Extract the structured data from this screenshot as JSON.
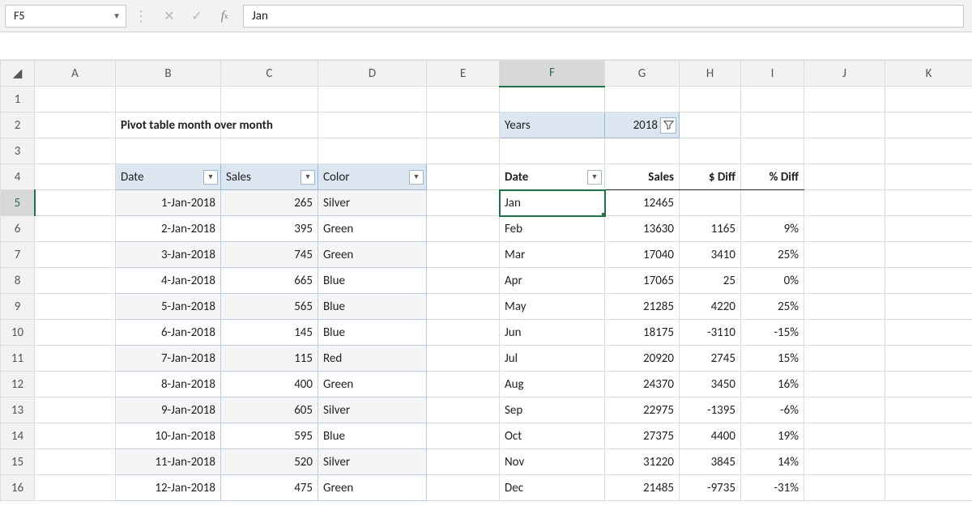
{
  "formula_bar": {
    "cell_ref": "F5",
    "value": "Jan"
  },
  "columns": [
    "A",
    "B",
    "C",
    "D",
    "E",
    "F",
    "G",
    "H",
    "I",
    "J",
    "K"
  ],
  "rownums": [
    1,
    2,
    3,
    4,
    5,
    6,
    7,
    8,
    9,
    10,
    11,
    12,
    13,
    14,
    15,
    16
  ],
  "title": "Pivot table month over month",
  "filter": {
    "label": "Years",
    "value": "2018"
  },
  "left_table": {
    "headers": {
      "date": "Date",
      "sales": "Sales",
      "color": "Color"
    },
    "rows": [
      {
        "date": "1-Jan-2018",
        "sales": "265",
        "color": "Silver"
      },
      {
        "date": "2-Jan-2018",
        "sales": "395",
        "color": "Green"
      },
      {
        "date": "3-Jan-2018",
        "sales": "745",
        "color": "Green"
      },
      {
        "date": "4-Jan-2018",
        "sales": "665",
        "color": "Blue"
      },
      {
        "date": "5-Jan-2018",
        "sales": "565",
        "color": "Blue"
      },
      {
        "date": "6-Jan-2018",
        "sales": "145",
        "color": "Blue"
      },
      {
        "date": "7-Jan-2018",
        "sales": "115",
        "color": "Red"
      },
      {
        "date": "8-Jan-2018",
        "sales": "400",
        "color": "Green"
      },
      {
        "date": "9-Jan-2018",
        "sales": "605",
        "color": "Silver"
      },
      {
        "date": "10-Jan-2018",
        "sales": "595",
        "color": "Blue"
      },
      {
        "date": "11-Jan-2018",
        "sales": "520",
        "color": "Silver"
      },
      {
        "date": "12-Jan-2018",
        "sales": "475",
        "color": "Green"
      }
    ]
  },
  "pivot": {
    "headers": {
      "date": "Date",
      "sales": "Sales",
      "diff": "$ Diff",
      "pct": "% Diff"
    },
    "rows": [
      {
        "m": "Jan",
        "sales": "12465",
        "diff": "",
        "pct": ""
      },
      {
        "m": "Feb",
        "sales": "13630",
        "diff": "1165",
        "pct": "9%"
      },
      {
        "m": "Mar",
        "sales": "17040",
        "diff": "3410",
        "pct": "25%"
      },
      {
        "m": "Apr",
        "sales": "17065",
        "diff": "25",
        "pct": "0%"
      },
      {
        "m": "May",
        "sales": "21285",
        "diff": "4220",
        "pct": "25%"
      },
      {
        "m": "Jun",
        "sales": "18175",
        "diff": "-3110",
        "pct": "-15%"
      },
      {
        "m": "Jul",
        "sales": "20920",
        "diff": "2745",
        "pct": "15%"
      },
      {
        "m": "Aug",
        "sales": "24370",
        "diff": "3450",
        "pct": "16%"
      },
      {
        "m": "Sep",
        "sales": "22975",
        "diff": "-1395",
        "pct": "-6%"
      },
      {
        "m": "Oct",
        "sales": "27375",
        "diff": "4400",
        "pct": "19%"
      },
      {
        "m": "Nov",
        "sales": "31220",
        "diff": "3845",
        "pct": "14%"
      },
      {
        "m": "Dec",
        "sales": "21485",
        "diff": "-9735",
        "pct": "-31%"
      }
    ]
  }
}
